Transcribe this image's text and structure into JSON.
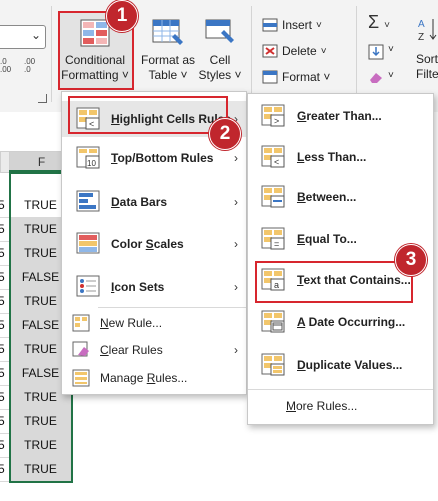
{
  "ribbon": {
    "number_format_value": "",
    "conditional_formatting": {
      "line1": "Conditional",
      "line2": "Formatting ˅"
    },
    "format_as_table": {
      "line1": "Format as",
      "line2": "Table ˅"
    },
    "cell_styles": {
      "line1": "Cell",
      "line2": "Styles ˅"
    },
    "insert_label": "Insert",
    "delete_label": "Delete",
    "format_label": "Format ˅",
    "sort_filter_line1": "Sort",
    "sort_filter_line2": "Filte",
    "sigma": "Σ",
    "dec_increase": ".0 .00",
    "dec_decrease": ".00 .0"
  },
  "sheet": {
    "column_f": "F",
    "column_e_partial": "5",
    "rows": [
      {
        "e": "5",
        "f": "TRUE"
      },
      {
        "e": "5",
        "f": "TRUE"
      },
      {
        "e": "5",
        "f": "TRUE"
      },
      {
        "e": "5",
        "f": "FALSE"
      },
      {
        "e": "5",
        "f": "TRUE"
      },
      {
        "e": "5",
        "f": "FALSE"
      },
      {
        "e": "5",
        "f": "TRUE"
      },
      {
        "e": "5",
        "f": "FALSE"
      },
      {
        "e": "5",
        "f": "TRUE"
      },
      {
        "e": "5",
        "f": "TRUE"
      },
      {
        "e": "5",
        "f": "TRUE"
      },
      {
        "e": "5",
        "f": "TRUE"
      }
    ]
  },
  "menu_main": {
    "items": [
      {
        "pre": "",
        "u": "H",
        "post": "ighlight Cells Rules",
        "icon": "highlight-cells-icon"
      },
      {
        "pre": "",
        "u": "T",
        "post": "op/Bottom Rules",
        "icon": "top-bottom-icon"
      },
      {
        "pre": "",
        "u": "D",
        "post": "ata Bars",
        "icon": "data-bars-icon"
      },
      {
        "pre": "Color ",
        "u": "S",
        "post": "cales",
        "icon": "color-scales-icon"
      },
      {
        "pre": "",
        "u": "I",
        "post": "con Sets",
        "icon": "icon-sets-icon"
      }
    ],
    "new_rule": {
      "pre": "",
      "u": "N",
      "post": "ew Rule..."
    },
    "clear_rules": {
      "pre": "",
      "u": "C",
      "post": "lear Rules"
    },
    "manage_rules": {
      "pre": "Manage ",
      "u": "R",
      "post": "ules..."
    }
  },
  "menu_sub": {
    "items": [
      {
        "pre": "",
        "u": "G",
        "post": "reater Than..."
      },
      {
        "pre": "",
        "u": "L",
        "post": "ess Than..."
      },
      {
        "pre": "",
        "u": "B",
        "post": "etween..."
      },
      {
        "pre": "",
        "u": "E",
        "post": "qual To..."
      },
      {
        "pre": "",
        "u": "T",
        "post": "ext that Contains..."
      },
      {
        "pre": "",
        "u": "A",
        "post": " Date Occurring..."
      },
      {
        "pre": "",
        "u": "D",
        "post": "uplicate Values..."
      }
    ],
    "more_rules": {
      "pre": "",
      "u": "M",
      "post": "ore Rules..."
    }
  },
  "badges": [
    "1",
    "2",
    "3"
  ],
  "colors": {
    "accent_red": "#d7262e",
    "badge_red": "#c0262d",
    "selection_green": "#217346"
  }
}
